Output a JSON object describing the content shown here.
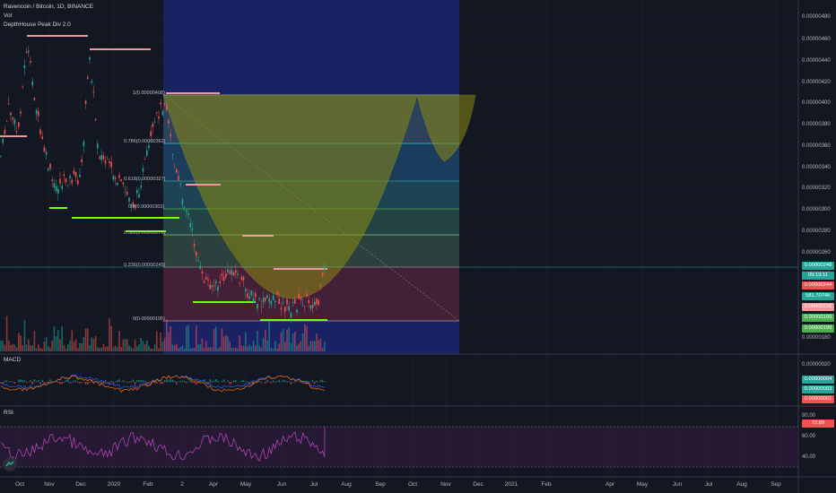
{
  "header": {
    "symbol": "Ravencoin / Bitcoin, 1D, BINANCE",
    "indicator1": "Vol",
    "indicator2": "DepthHouse Peak Div 2.0"
  },
  "panes": {
    "macd_label": "MACD",
    "rsi_label": "RSI"
  },
  "price_axis": [
    "0.00000480",
    "0.00000460",
    "0.00000440",
    "0.00000420",
    "0.00000400",
    "0.00000380",
    "0.00000360",
    "0.00000340",
    "0.00000320",
    "0.00000300",
    "0.00000280",
    "0.00000260",
    "0.00000240",
    "0.00000220",
    "0.00000200",
    "0.00000180"
  ],
  "price_tags": [
    {
      "text": "0.00000248",
      "color": "#26a69a"
    },
    {
      "text": "09:19:11",
      "color": "#26a69a"
    },
    {
      "text": "0.00000244",
      "color": "#ef5350"
    },
    {
      "text": "581.7074K",
      "color": "#26a69a"
    },
    {
      "text": "0.00000226",
      "color": "#ef9a9a"
    },
    {
      "text": "0.00000199",
      "color": "#4caf50"
    },
    {
      "text": "0.00000199",
      "color": "#4caf50"
    }
  ],
  "macd_axis": [
    "0.00000020"
  ],
  "macd_tags": [
    {
      "text": "0.00000004",
      "color": "#26a69a"
    },
    {
      "text": "0.00000003",
      "color": "#26a69a"
    },
    {
      "text": "0.00000001",
      "color": "#ef5350"
    }
  ],
  "rsi_axis": [
    "80.00",
    "60.00",
    "40.00"
  ],
  "rsi_tags": [
    {
      "text": "72.89",
      "color": "#ef5350"
    }
  ],
  "fib_levels": [
    {
      "label": "1(0.00000408)"
    },
    {
      "label": "0.786(0.00000362)"
    },
    {
      "label": "0.618(0.00000327)"
    },
    {
      "label": "0.5(0.00000302)"
    },
    {
      "label": "0.382(0.00000276)"
    },
    {
      "label": "0.236(0.00000245)"
    },
    {
      "label": "0(0.00000195)"
    }
  ],
  "time_axis": [
    "Oct",
    "Nov",
    "Dec",
    "2020",
    "Feb",
    "2",
    "Apr",
    "May",
    "Jun",
    "Jul",
    "Aug",
    "Sep",
    "Oct",
    "Nov",
    "Dec",
    "2021",
    "Feb",
    "Apr",
    "May",
    "Jun",
    "Jul",
    "Aug",
    "Sep"
  ],
  "colors": {
    "background": "#131722",
    "up": "#26a69a",
    "down": "#ef5350",
    "rsi": "#b044b0",
    "macd_line": "#2962ff",
    "signal_line": "#ff6d00"
  }
}
